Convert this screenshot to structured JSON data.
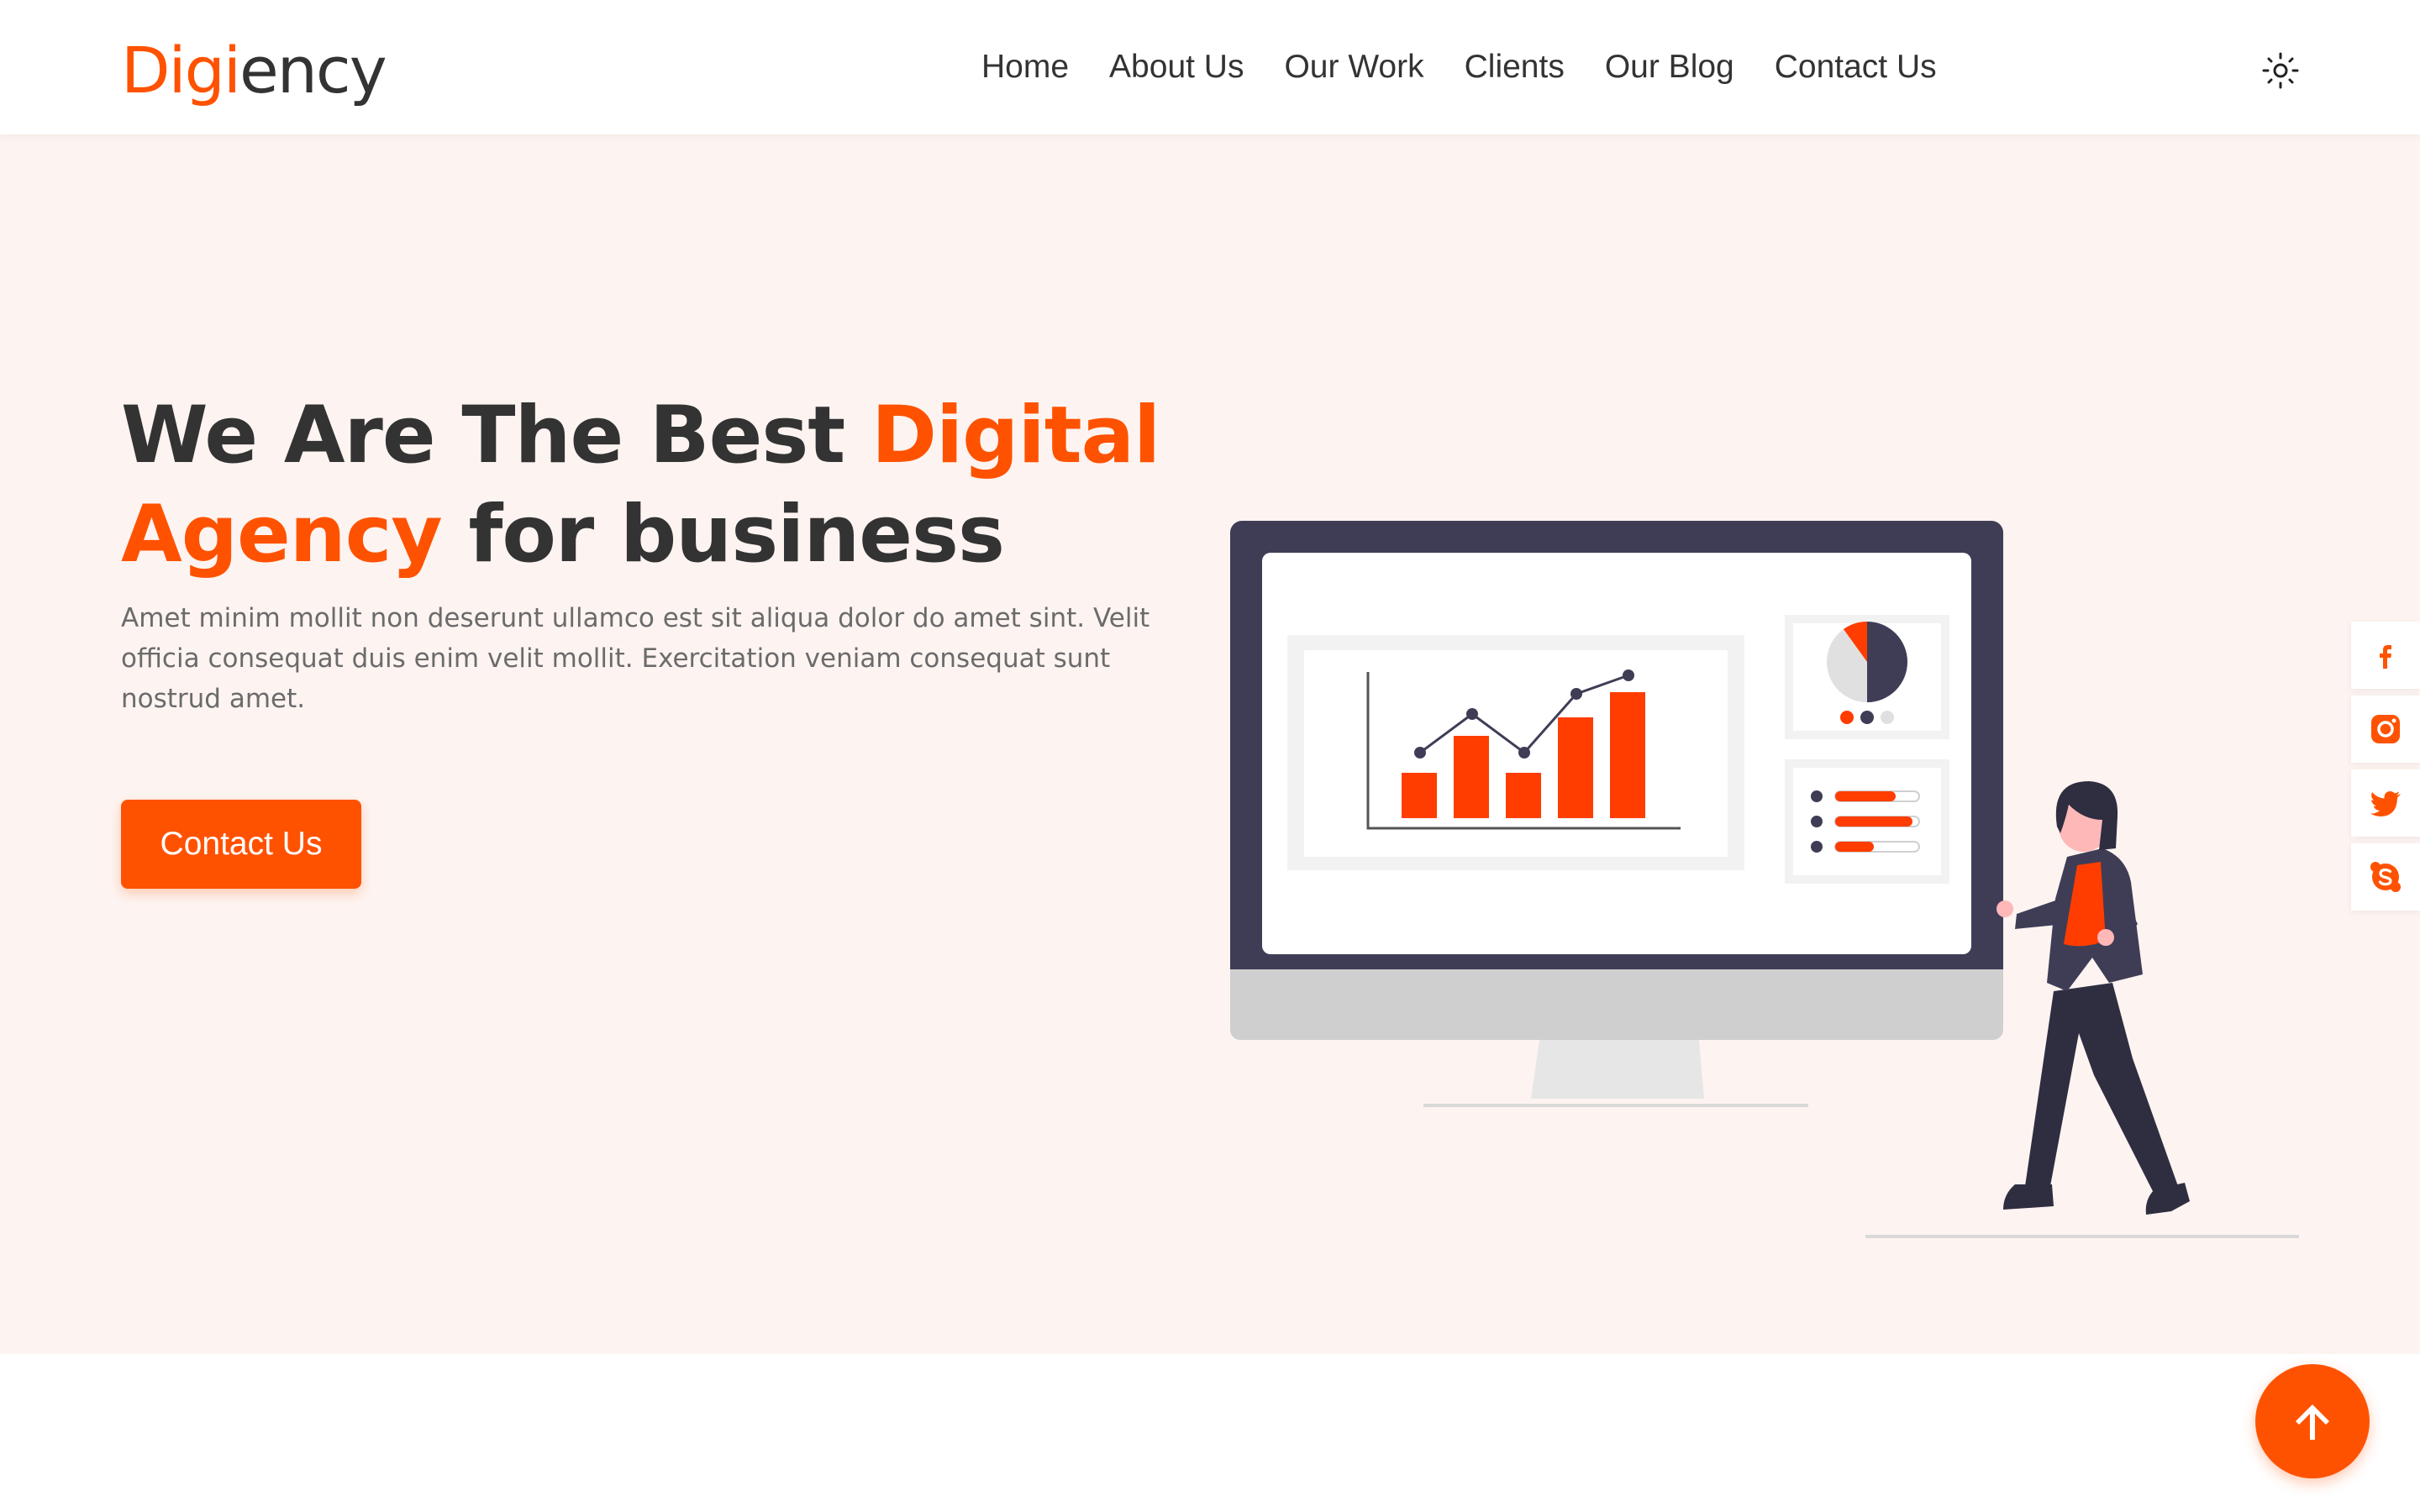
{
  "brand": {
    "logo_part1": "Digi",
    "logo_part2": "ency"
  },
  "nav": {
    "items": [
      "Home",
      "About Us",
      "Our Work",
      "Clients",
      "Our Blog",
      "Contact Us"
    ],
    "theme_icon": "sun-icon"
  },
  "hero": {
    "headline_part1": "We Are The Best ",
    "headline_accent1": "Digital",
    "headline_accent2": "Agency",
    "headline_part2": " for business",
    "subtext": "Amet minim mollit non deserunt ullamco est sit aliqua dolor do amet sint. Velit officia consequat duis enim velit mollit. Exercitation veniam consequat sunt nostrud amet.",
    "cta_label": "Contact Us"
  },
  "socials": [
    "facebook-icon",
    "instagram-icon",
    "twitter-icon",
    "skype-icon"
  ],
  "back_to_top_icon": "arrow-up-icon",
  "colors": {
    "accent": "#ff5200",
    "hero_bg": "#fdf4f1",
    "text": "#333333",
    "muted": "#6b6b6b",
    "monitor": "#3f3d56"
  }
}
